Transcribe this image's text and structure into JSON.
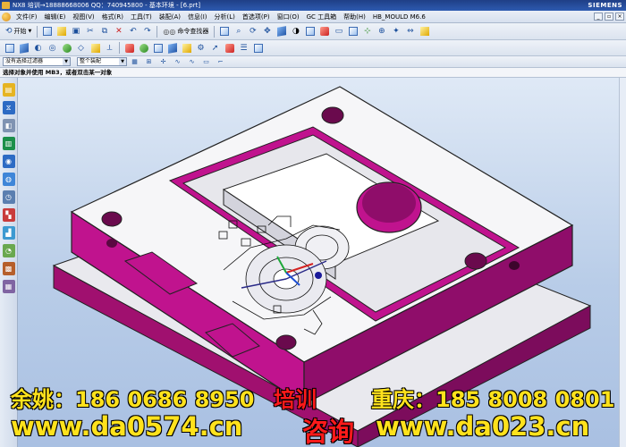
{
  "window": {
    "title": "NX8 培训→18888668006 QQ：740945800 - 基本环境 - [6.prt]",
    "brand": "SIEMENS"
  },
  "menu": {
    "items": [
      "文件(F)",
      "编辑(E)",
      "视图(V)",
      "格式(R)",
      "工具(T)",
      "装配(A)",
      "信息(I)",
      "分析(L)",
      "首选项(P)",
      "窗口(O)",
      "GC 工具箱",
      "帮助(H)",
      "HB_MOULD M6.6"
    ]
  },
  "toolbar": {
    "start_label": "开始",
    "command_finder_label": "命令查找器"
  },
  "selection_bar": {
    "type_filter": "没有选择过滤器",
    "scope": "整个装配"
  },
  "prompt": {
    "text": "选择对象并使用 MB3，或者双击某一对象"
  },
  "watermark": {
    "line1_left": "余姚：186 0686 8950",
    "line1_mid": "培训",
    "line1_right": "重庆：185 8008 0801",
    "line2_left": "www.da0574.cn",
    "line2_mid": "咨询",
    "line2_right": "www.da023.cn"
  },
  "colors": {
    "mold_top": "#f7f7f7",
    "mold_side": "#c0138e",
    "mold_dark": "#8f0d6a",
    "watermark_yellow": "#ffe21c",
    "watermark_red": "#ff1a1a"
  }
}
